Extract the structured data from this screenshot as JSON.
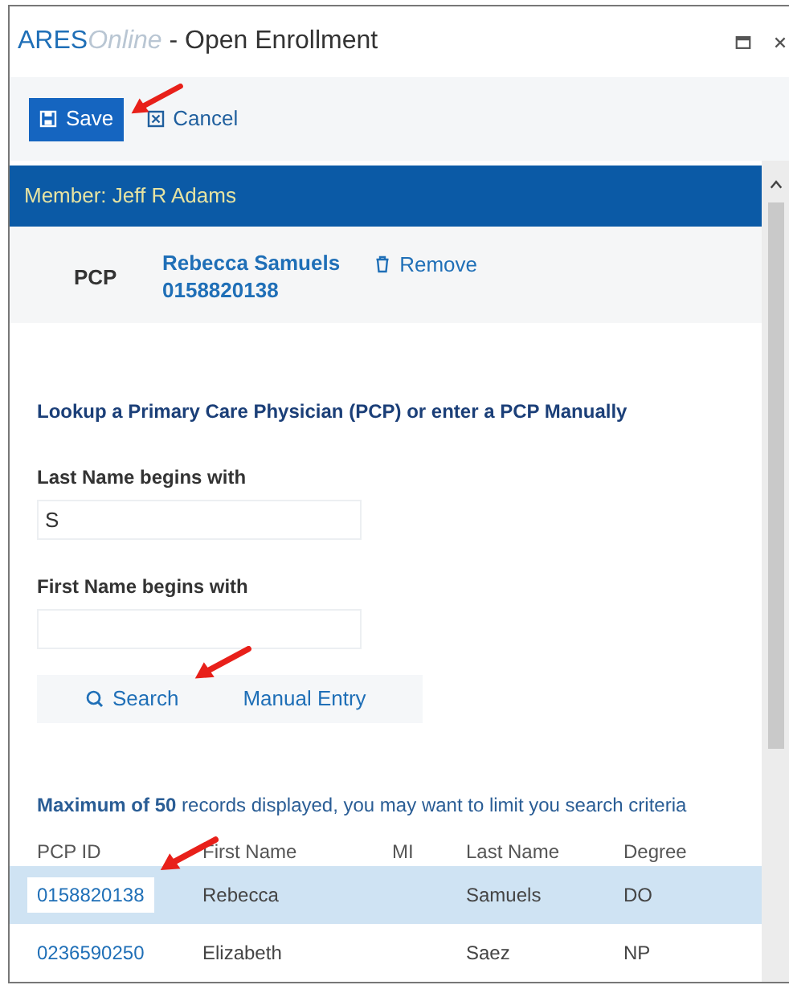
{
  "window": {
    "title_brand": "ARES",
    "title_brand_suffix": "Online",
    "title": " - Open Enrollment"
  },
  "toolbar": [
    {
      "label": "Save",
      "kind": "primary"
    },
    {
      "label": "Cancel",
      "kind": "plain"
    }
  ],
  "member_bar": "Member: Jeff R Adams",
  "pcp": {
    "label": "PCP",
    "name": "Rebecca Samuels",
    "id": "0158820138",
    "remove": "Remove"
  },
  "lookup": {
    "heading": "Lookup a Primary Care Physician (PCP) or enter a PCP Manually",
    "fields": [
      {
        "label": "Last Name begins with",
        "value": "S"
      },
      {
        "label": "First Name begins with"
      }
    ],
    "buttons": [
      {
        "label": "Search",
        "kind": "search"
      },
      {
        "label": "Manual Entry",
        "kind": "plain"
      }
    ]
  },
  "notice": "**Maximum of 50** records displayed, you may want to limit you search criteria",
  "table": {
    "columns": [
      "PCP ID",
      "First Name",
      "MI",
      "Last Name",
      "Degree"
    ],
    "rows": [
      {
        "cells": [
          "0158820138",
          "Rebecca",
          "",
          "Samuels",
          "DO"
        ],
        "selected": true
      },
      {
        "cells": [
          "0236590250",
          "Elizabeth",
          "",
          "Saez",
          "NP"
        ],
        "selected": false
      }
    ]
  }
}
